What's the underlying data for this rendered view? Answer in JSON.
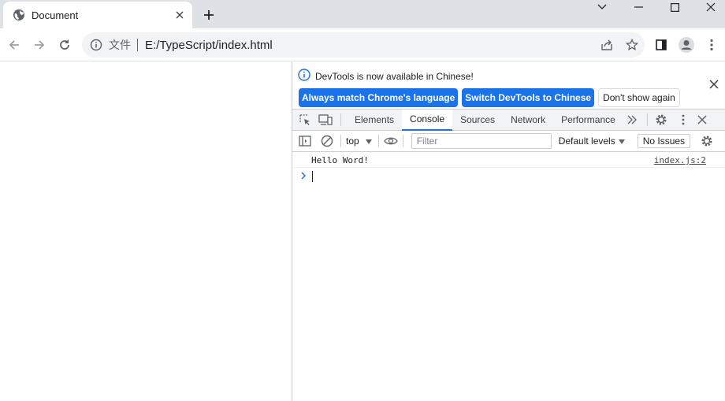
{
  "tab": {
    "title": "Document",
    "icon": "globe-icon"
  },
  "window_controls": [
    "chevron-down-icon",
    "minimize-icon",
    "maximize-icon",
    "close-icon"
  ],
  "address": {
    "scheme_label": "文件",
    "url": "E:/TypeScript/index.html"
  },
  "devtools": {
    "infobar": {
      "message": "DevTools is now available in Chinese!",
      "buttons": [
        "Always match Chrome's language",
        "Switch DevTools to Chinese",
        "Don't show again"
      ]
    },
    "tabs": [
      "Elements",
      "Console",
      "Sources",
      "Network",
      "Performance"
    ],
    "active_tab": "Console",
    "console": {
      "context": "top",
      "filter_placeholder": "Filter",
      "levels": "Default levels",
      "issues": "No Issues",
      "messages": [
        {
          "text": "Hello Word!",
          "source": "index.js:2"
        }
      ]
    }
  },
  "colors": {
    "accent": "#1a73e8",
    "tabbar": "#dee1e6",
    "omnibox": "#f1f3f4"
  }
}
